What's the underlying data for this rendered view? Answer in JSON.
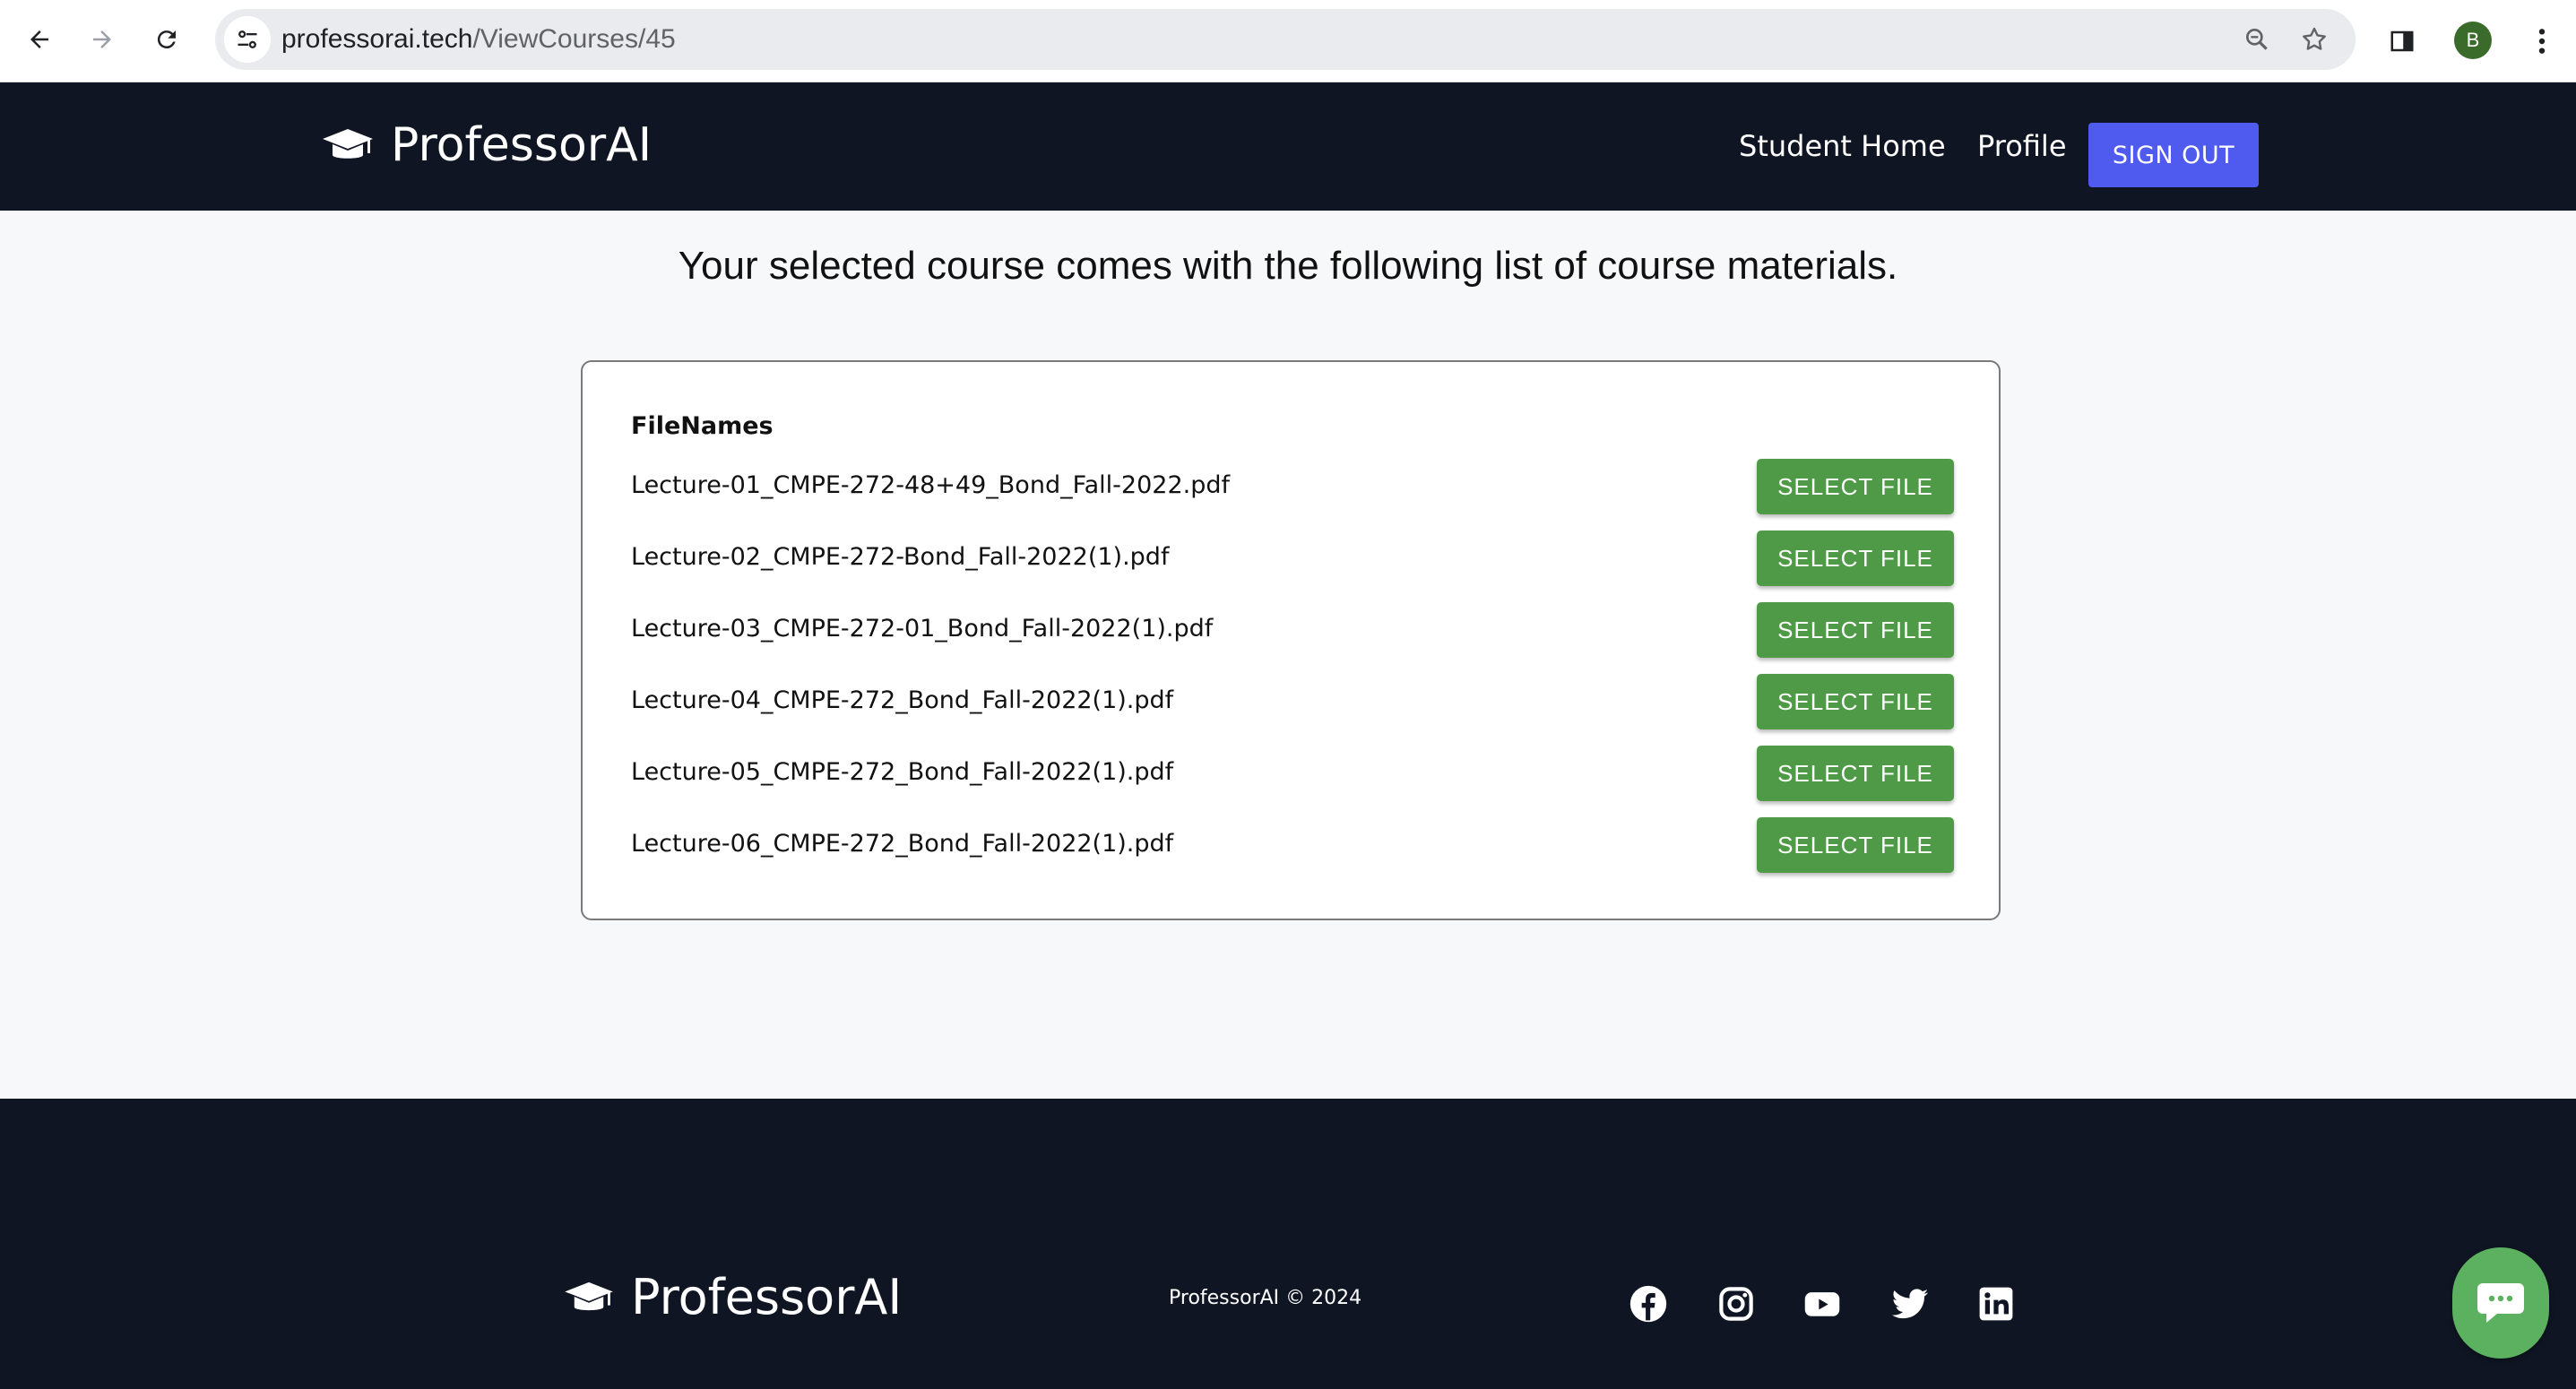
{
  "browser": {
    "url_host": "professorai.tech",
    "url_path": "/ViewCourses/45",
    "profile_initial": "B"
  },
  "header": {
    "brand": "ProfessorAI",
    "nav": {
      "student_home": "Student Home",
      "profile": "Profile",
      "sign_out": "SIGN OUT"
    }
  },
  "main": {
    "heading": "Your selected course comes with the following list of course materials.",
    "column_header": "FileNames",
    "select_label": "SELECT FILE",
    "files": [
      "Lecture-01_CMPE-272-48+49_Bond_Fall-2022.pdf",
      "Lecture-02_CMPE-272-Bond_Fall-2022(1).pdf",
      "Lecture-03_CMPE-272-01_Bond_Fall-2022(1).pdf",
      "Lecture-04_CMPE-272_Bond_Fall-2022(1).pdf",
      "Lecture-05_CMPE-272_Bond_Fall-2022(1).pdf",
      "Lecture-06_CMPE-272_Bond_Fall-2022(1).pdf"
    ]
  },
  "footer": {
    "brand": "ProfessorAI",
    "copyright": "ProfessorAI © 2024",
    "social_icons": [
      "facebook-icon",
      "instagram-icon",
      "youtube-icon",
      "twitter-icon",
      "linkedin-icon"
    ]
  },
  "colors": {
    "header_bg": "#0f1523",
    "sign_out_bg": "#4f5bef",
    "select_button_bg": "#4e9a46",
    "chat_bubble_bg": "#5bb15f"
  }
}
